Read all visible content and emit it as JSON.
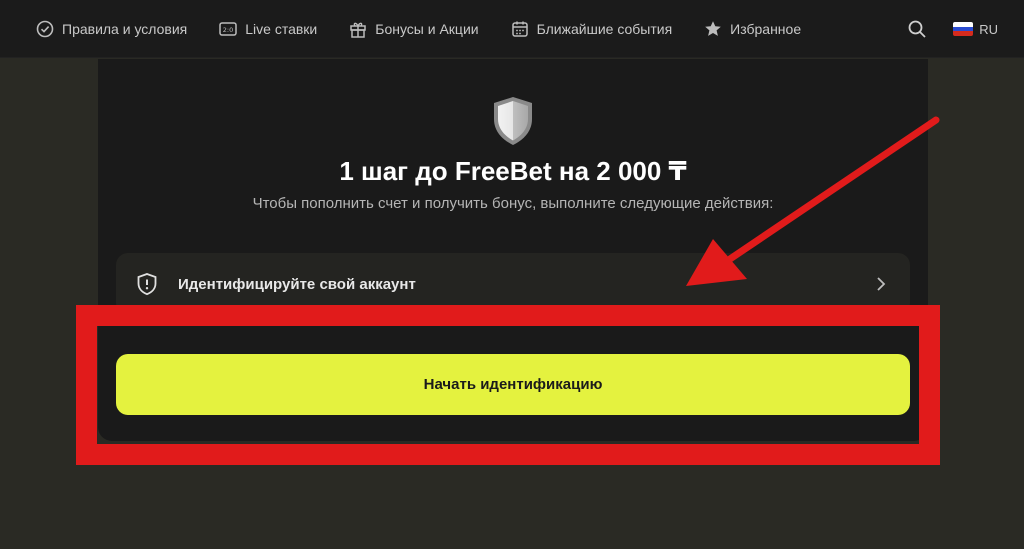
{
  "nav": {
    "items": [
      {
        "label": "Правила и условия",
        "icon": "check-circle-icon"
      },
      {
        "label": "Live ставки",
        "icon": "scoreboard-icon"
      },
      {
        "label": "Бонусы и Акции",
        "icon": "gift-icon"
      },
      {
        "label": "Ближайшие события",
        "icon": "calendar-icon"
      },
      {
        "label": "Избранное",
        "icon": "star-icon"
      }
    ],
    "search_icon": "search-icon",
    "language": "RU"
  },
  "card": {
    "title": "1 шаг до FreeBet на 2 000 ₸",
    "subtitle": "Чтобы пополнить счет и получить бонус, выполните следующие действия:",
    "step": {
      "label": "Идентифицируйте свой аккаунт",
      "icon": "shield-alert-icon"
    },
    "cta_label": "Начать идентификацию"
  },
  "colors": {
    "accent": "#e4f23f",
    "annotation": "#e11b1b",
    "background": "#2a2a24",
    "card": "#1a1a1a"
  }
}
